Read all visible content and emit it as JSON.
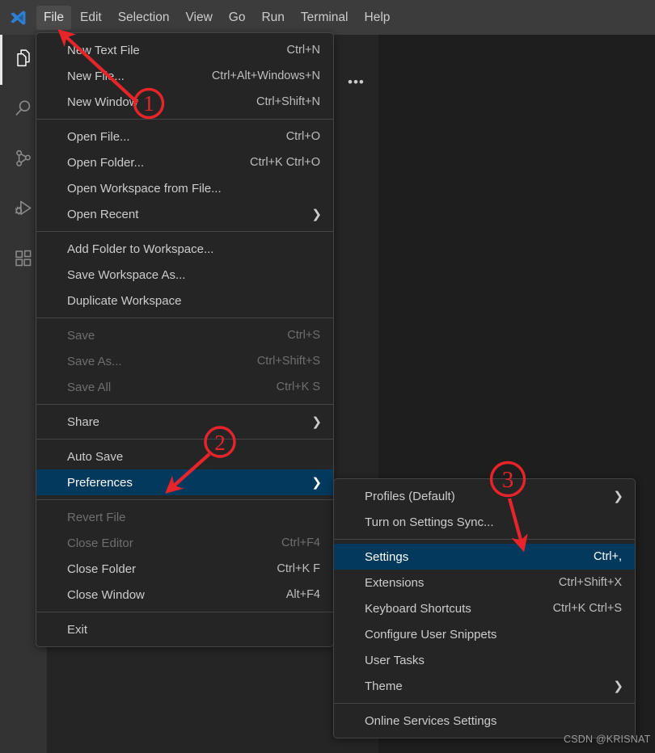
{
  "app": {
    "name": "Visual Studio Code",
    "logo_icon": "vscode-logo-icon",
    "theme_colors": {
      "titlebar_bg": "#3c3c3c",
      "activitybar_bg": "#333333",
      "sidebar_bg": "#252526",
      "editor_bg": "#1e1e1e",
      "menu_bg": "#252526",
      "menu_border": "#454545",
      "menu_selected_bg": "#04395e",
      "text": "#cccccc",
      "text_disabled": "#6e6e6e",
      "annotation_red": "#e8242b"
    }
  },
  "menubar": {
    "items": [
      {
        "label": "File",
        "open": true
      },
      {
        "label": "Edit",
        "open": false
      },
      {
        "label": "Selection",
        "open": false
      },
      {
        "label": "View",
        "open": false
      },
      {
        "label": "Go",
        "open": false
      },
      {
        "label": "Run",
        "open": false
      },
      {
        "label": "Terminal",
        "open": false
      },
      {
        "label": "Help",
        "open": false
      }
    ]
  },
  "activitybar": {
    "items": [
      {
        "icon": "explorer-files-icon",
        "name": "explorer",
        "active": true
      },
      {
        "icon": "search-magnifier-icon",
        "name": "search",
        "active": false
      },
      {
        "icon": "source-control-branch-icon",
        "name": "source-control",
        "active": false
      },
      {
        "icon": "run-and-debug-icon",
        "name": "run-debug",
        "active": false
      },
      {
        "icon": "extensions-blocks-icon",
        "name": "extensions",
        "active": false
      }
    ]
  },
  "sidebar": {
    "more_actions_label": "•••",
    "more_actions_icon": "ellipsis-icon"
  },
  "file_menu": {
    "title": "File",
    "groups": [
      {
        "items": [
          {
            "label": "New Text File",
            "keybinding": "Ctrl+N",
            "disabled": false,
            "submenu": false,
            "selected": false
          },
          {
            "label": "New File...",
            "keybinding": "Ctrl+Alt+Windows+N",
            "disabled": false,
            "submenu": false,
            "selected": false
          },
          {
            "label": "New Window",
            "keybinding": "Ctrl+Shift+N",
            "disabled": false,
            "submenu": false,
            "selected": false
          }
        ]
      },
      {
        "items": [
          {
            "label": "Open File...",
            "keybinding": "Ctrl+O",
            "disabled": false,
            "submenu": false,
            "selected": false
          },
          {
            "label": "Open Folder...",
            "keybinding": "Ctrl+K Ctrl+O",
            "disabled": false,
            "submenu": false,
            "selected": false
          },
          {
            "label": "Open Workspace from File...",
            "keybinding": "",
            "disabled": false,
            "submenu": false,
            "selected": false
          },
          {
            "label": "Open Recent",
            "keybinding": "",
            "disabled": false,
            "submenu": true,
            "selected": false
          }
        ]
      },
      {
        "items": [
          {
            "label": "Add Folder to Workspace...",
            "keybinding": "",
            "disabled": false,
            "submenu": false,
            "selected": false
          },
          {
            "label": "Save Workspace As...",
            "keybinding": "",
            "disabled": false,
            "submenu": false,
            "selected": false
          },
          {
            "label": "Duplicate Workspace",
            "keybinding": "",
            "disabled": false,
            "submenu": false,
            "selected": false
          }
        ]
      },
      {
        "items": [
          {
            "label": "Save",
            "keybinding": "Ctrl+S",
            "disabled": true,
            "submenu": false,
            "selected": false
          },
          {
            "label": "Save As...",
            "keybinding": "Ctrl+Shift+S",
            "disabled": true,
            "submenu": false,
            "selected": false
          },
          {
            "label": "Save All",
            "keybinding": "Ctrl+K S",
            "disabled": true,
            "submenu": false,
            "selected": false
          }
        ]
      },
      {
        "items": [
          {
            "label": "Share",
            "keybinding": "",
            "disabled": false,
            "submenu": true,
            "selected": false
          }
        ]
      },
      {
        "items": [
          {
            "label": "Auto Save",
            "keybinding": "",
            "disabled": false,
            "submenu": false,
            "selected": false
          },
          {
            "label": "Preferences",
            "keybinding": "",
            "disabled": false,
            "submenu": true,
            "selected": true
          }
        ]
      },
      {
        "items": [
          {
            "label": "Revert File",
            "keybinding": "",
            "disabled": true,
            "submenu": false,
            "selected": false
          },
          {
            "label": "Close Editor",
            "keybinding": "Ctrl+F4",
            "disabled": true,
            "submenu": false,
            "selected": false
          },
          {
            "label": "Close Folder",
            "keybinding": "Ctrl+K F",
            "disabled": false,
            "submenu": false,
            "selected": false
          },
          {
            "label": "Close Window",
            "keybinding": "Alt+F4",
            "disabled": false,
            "submenu": false,
            "selected": false
          }
        ]
      },
      {
        "items": [
          {
            "label": "Exit",
            "keybinding": "",
            "disabled": false,
            "submenu": false,
            "selected": false
          }
        ]
      }
    ]
  },
  "preferences_menu": {
    "title": "Preferences",
    "groups": [
      {
        "items": [
          {
            "label": "Profiles (Default)",
            "keybinding": "",
            "disabled": false,
            "submenu": true,
            "selected": false
          },
          {
            "label": "Turn on Settings Sync...",
            "keybinding": "",
            "disabled": false,
            "submenu": false,
            "selected": false
          }
        ]
      },
      {
        "items": [
          {
            "label": "Settings",
            "keybinding": "Ctrl+,",
            "disabled": false,
            "submenu": false,
            "selected": true
          },
          {
            "label": "Extensions",
            "keybinding": "Ctrl+Shift+X",
            "disabled": false,
            "submenu": false,
            "selected": false
          },
          {
            "label": "Keyboard Shortcuts",
            "keybinding": "Ctrl+K Ctrl+S",
            "disabled": false,
            "submenu": false,
            "selected": false
          },
          {
            "label": "Configure User Snippets",
            "keybinding": "",
            "disabled": false,
            "submenu": false,
            "selected": false
          },
          {
            "label": "User Tasks",
            "keybinding": "",
            "disabled": false,
            "submenu": false,
            "selected": false
          },
          {
            "label": "Theme",
            "keybinding": "",
            "disabled": false,
            "submenu": true,
            "selected": false
          }
        ]
      },
      {
        "items": [
          {
            "label": "Online Services Settings",
            "keybinding": "",
            "disabled": false,
            "submenu": false,
            "selected": false
          }
        ]
      }
    ]
  },
  "annotations": {
    "color": "#e8242b",
    "steps": [
      {
        "number": "1",
        "target": "File menu button"
      },
      {
        "number": "2",
        "target": "Preferences"
      },
      {
        "number": "3",
        "target": "Settings"
      }
    ]
  },
  "watermark": {
    "text": "CSDN @KRISNAT"
  }
}
